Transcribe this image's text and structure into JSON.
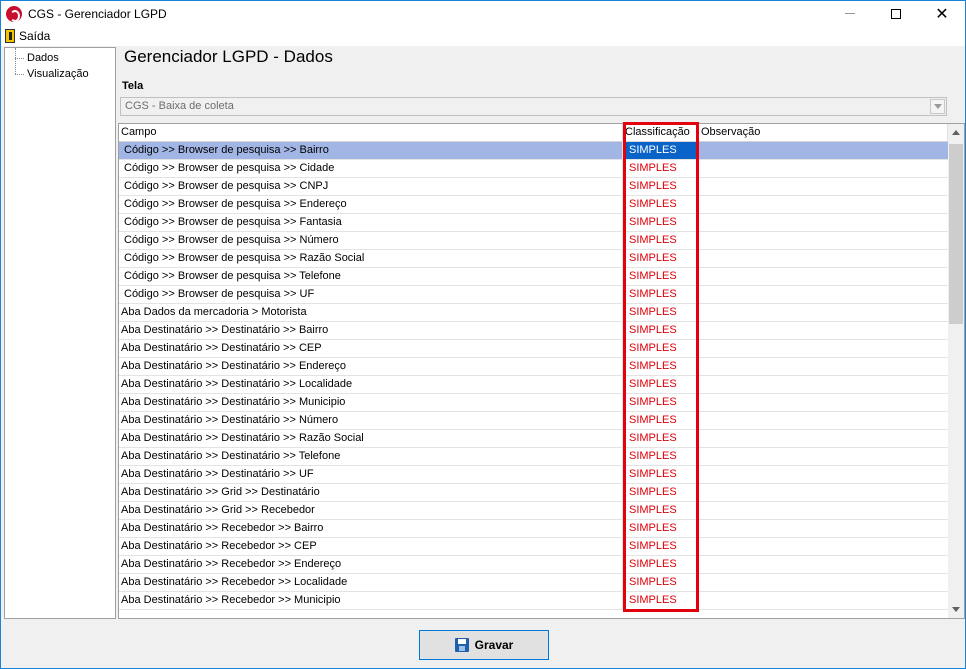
{
  "window": {
    "title": "CGS - Gerenciador LGPD",
    "controls": {
      "minimize": "—",
      "maximize": "☐",
      "close": "✕"
    }
  },
  "menu": {
    "exit_label": "Saída",
    "exit_icon": "exit-door-icon"
  },
  "tree": {
    "items": [
      "Dados",
      "Visualização"
    ]
  },
  "page": {
    "title": "Gerenciador LGPD - Dados"
  },
  "screen_field": {
    "label": "Tela",
    "value": "CGS - Baixa de coleta"
  },
  "grid": {
    "columns": [
      "Campo",
      "Classificação",
      "Observação"
    ],
    "selected_row": 0,
    "rows": [
      {
        "campo": "Código >> Browser de pesquisa >> Bairro",
        "classificacao": "SIMPLES",
        "observacao": ""
      },
      {
        "campo": "Código >> Browser de pesquisa >> Cidade",
        "classificacao": "SIMPLES",
        "observacao": ""
      },
      {
        "campo": "Código >> Browser de pesquisa >> CNPJ",
        "classificacao": "SIMPLES",
        "observacao": ""
      },
      {
        "campo": "Código >> Browser de pesquisa >> Endereço",
        "classificacao": "SIMPLES",
        "observacao": ""
      },
      {
        "campo": "Código >> Browser de pesquisa >> Fantasia",
        "classificacao": "SIMPLES",
        "observacao": ""
      },
      {
        "campo": "Código >> Browser de pesquisa >> Número",
        "classificacao": "SIMPLES",
        "observacao": ""
      },
      {
        "campo": "Código >> Browser de pesquisa >> Razão Social",
        "classificacao": "SIMPLES",
        "observacao": ""
      },
      {
        "campo": "Código >> Browser de pesquisa >> Telefone",
        "classificacao": "SIMPLES",
        "observacao": ""
      },
      {
        "campo": "Código >> Browser de pesquisa >> UF",
        "classificacao": "SIMPLES",
        "observacao": ""
      },
      {
        "campo": "Aba Dados da mercadoria > Motorista",
        "classificacao": "SIMPLES",
        "observacao": ""
      },
      {
        "campo": "Aba Destinatário >> Destinatário >> Bairro",
        "classificacao": "SIMPLES",
        "observacao": ""
      },
      {
        "campo": "Aba Destinatário >> Destinatário >> CEP",
        "classificacao": "SIMPLES",
        "observacao": ""
      },
      {
        "campo": "Aba Destinatário >> Destinatário >> Endereço",
        "classificacao": "SIMPLES",
        "observacao": ""
      },
      {
        "campo": "Aba Destinatário >> Destinatário >> Localidade",
        "classificacao": "SIMPLES",
        "observacao": ""
      },
      {
        "campo": "Aba Destinatário >> Destinatário >> Municipio",
        "classificacao": "SIMPLES",
        "observacao": ""
      },
      {
        "campo": "Aba Destinatário >> Destinatário >> Número",
        "classificacao": "SIMPLES",
        "observacao": ""
      },
      {
        "campo": "Aba Destinatário >> Destinatário >> Razão Social",
        "classificacao": "SIMPLES",
        "observacao": ""
      },
      {
        "campo": "Aba Destinatário >> Destinatário >> Telefone",
        "classificacao": "SIMPLES",
        "observacao": ""
      },
      {
        "campo": "Aba Destinatário >> Destinatário >> UF",
        "classificacao": "SIMPLES",
        "observacao": ""
      },
      {
        "campo": "Aba Destinatário >> Grid >> Destinatário",
        "classificacao": "SIMPLES",
        "observacao": ""
      },
      {
        "campo": "Aba Destinatário >> Grid >> Recebedor",
        "classificacao": "SIMPLES",
        "observacao": ""
      },
      {
        "campo": "Aba Destinatário >> Recebedor >> Bairro",
        "classificacao": "SIMPLES",
        "observacao": ""
      },
      {
        "campo": "Aba Destinatário >> Recebedor >> CEP",
        "classificacao": "SIMPLES",
        "observacao": ""
      },
      {
        "campo": "Aba Destinatário >> Recebedor >> Endereço",
        "classificacao": "SIMPLES",
        "observacao": ""
      },
      {
        "campo": "Aba Destinatário >> Recebedor >> Localidade",
        "classificacao": "SIMPLES",
        "observacao": ""
      },
      {
        "campo": "Aba Destinatário >> Recebedor >> Municipio",
        "classificacao": "SIMPLES",
        "observacao": ""
      }
    ]
  },
  "actions": {
    "save_label": "Gravar",
    "save_icon": "floppy-disk-icon"
  },
  "colors": {
    "selected_row": "#a2b6e6",
    "selected_cell": "#0a63c9",
    "classification_text": "#e0000b",
    "highlight_border": "#e3000f"
  }
}
